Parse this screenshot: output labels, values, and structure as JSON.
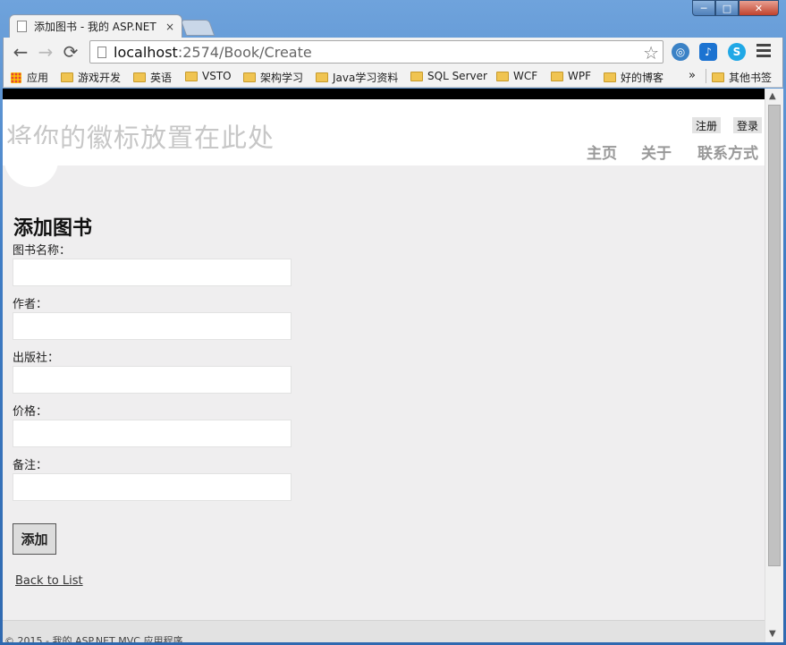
{
  "window": {
    "minimize": "─",
    "maximize": "□",
    "close": "✕"
  },
  "tab": {
    "title": "添加图书 - 我的 ASP.NET",
    "close": "×"
  },
  "toolbar": {
    "url_host": "localhost",
    "url_rest": ":2574/Book/Create",
    "back": "←",
    "forward": "→",
    "reload": "⟳",
    "star": "☆"
  },
  "bookmarks": {
    "apps": "应用",
    "items": [
      "游戏开发",
      "英语",
      "VSTO",
      "架构学习",
      "Java学习资料",
      "SQL Server",
      "WCF",
      "WPF",
      "好的博客"
    ],
    "more": "»",
    "other": "其他书签"
  },
  "site": {
    "logo": "将你的徽标放置在此处",
    "register": "注册",
    "login": "登录",
    "nav": {
      "home": "主页",
      "about": "关于",
      "contact": "联系方式"
    }
  },
  "form": {
    "title": "添加图书",
    "fields": [
      {
        "label": "图书名称：",
        "value": ""
      },
      {
        "label": "作者：",
        "value": ""
      },
      {
        "label": "出版社：",
        "value": ""
      },
      {
        "label": "价格：",
        "value": ""
      },
      {
        "label": "备注：",
        "value": ""
      }
    ],
    "submit": "添加",
    "back_link": "Back to List"
  },
  "footer": {
    "text": "© 2015 - 我的 ASP.NET MVC 应用程序"
  }
}
